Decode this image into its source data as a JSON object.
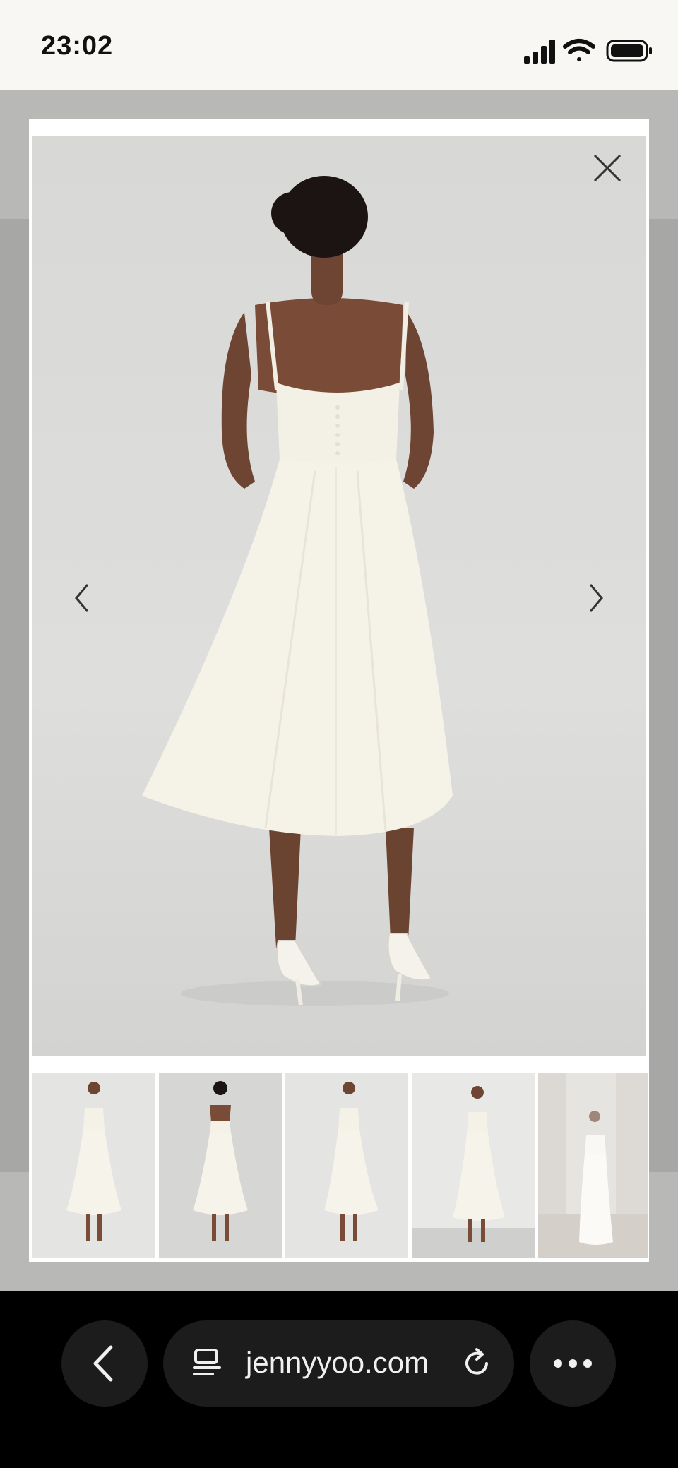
{
  "status_bar": {
    "time": "23:02",
    "icons": [
      "signal-icon",
      "wifi-icon",
      "battery-icon"
    ]
  },
  "gallery": {
    "close_icon": "close-icon",
    "prev_icon": "chevron-left-icon",
    "next_icon": "chevron-right-icon",
    "selected_index": 1,
    "thumbnails": [
      {
        "view": "front"
      },
      {
        "view": "back"
      },
      {
        "view": "front"
      },
      {
        "view": "side"
      },
      {
        "view": "venue"
      }
    ]
  },
  "browser": {
    "url": "jennyyoo.com",
    "back_icon": "chevron-left-icon",
    "tabs_icon": "tab-overview-icon",
    "reload_icon": "reload-icon",
    "more_icon": "more-icon"
  },
  "colors": {
    "status_bar_bg": "#f8f7f3",
    "page_overlay": "#b8b8b6",
    "browser_bar_bg": "#000000",
    "pill_bg": "#1c1c1c",
    "dress": "#f5f2e8"
  }
}
